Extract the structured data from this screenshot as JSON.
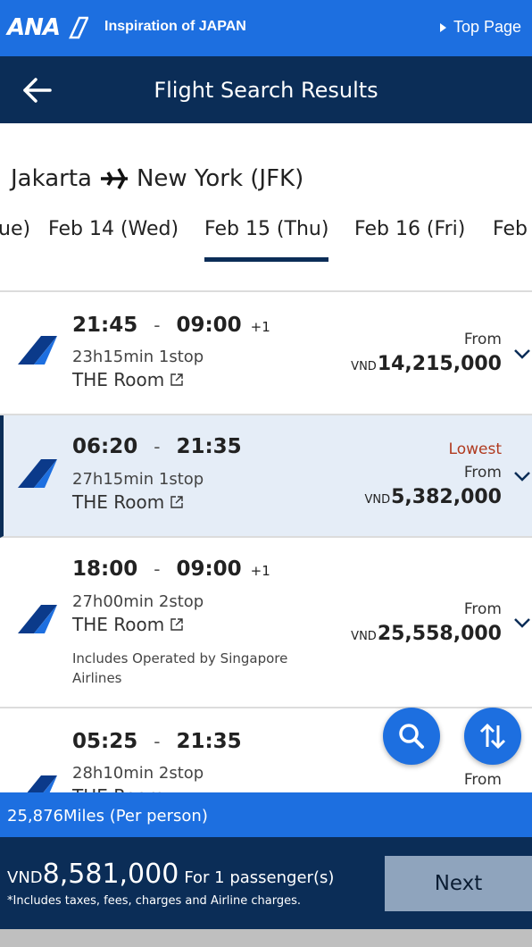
{
  "brand": {
    "logo_text": "ANA",
    "tagline": "Inspiration of JAPAN",
    "top_page": "Top Page"
  },
  "header": {
    "title": "Flight Search Results"
  },
  "route": {
    "origin": "Jakarta",
    "destination": "New York (JFK)"
  },
  "date_tabs": [
    {
      "label": "ue)",
      "active": false
    },
    {
      "label": "Feb 14 (Wed)",
      "active": false
    },
    {
      "label": "Feb 15 (Thu)",
      "active": true
    },
    {
      "label": "Feb 16 (Fri)",
      "active": false
    },
    {
      "label": "Feb",
      "active": false
    }
  ],
  "flights": [
    {
      "depart": "21:45",
      "arrive": "09:00",
      "day_offset": "+1",
      "duration": "23h15min 1stop",
      "lounge": "THE Room",
      "note": "",
      "badge": "",
      "from": "From",
      "currency": "VND",
      "price": "14,215,000",
      "selected": false
    },
    {
      "depart": "06:20",
      "arrive": "21:35",
      "day_offset": "",
      "duration": "27h15min 1stop",
      "lounge": "THE Room",
      "note": "",
      "badge": "Lowest",
      "from": "From",
      "currency": "VND",
      "price": "5,382,000",
      "selected": true
    },
    {
      "depart": "18:00",
      "arrive": "09:00",
      "day_offset": "+1",
      "duration": "27h00min 2stop",
      "lounge": "THE Room",
      "note": "Includes Operated by Singapore Airlines",
      "badge": "",
      "from": "From",
      "currency": "VND",
      "price": "25,558,000",
      "selected": false
    },
    {
      "depart": "05:25",
      "arrive": "21:35",
      "day_offset": "",
      "duration": "28h10min 2stop",
      "lounge": "THE Room",
      "note": "",
      "badge": "",
      "from": "From",
      "currency": "VND",
      "price": "",
      "selected": false
    }
  ],
  "miles": {
    "text": "25,876Miles (Per person)"
  },
  "total": {
    "currency": "VND",
    "amount": "8,581,000",
    "passengers": "For 1 passenger(s)",
    "note": "*Includes taxes, fees, charges and Airline charges.",
    "next_label": "Next"
  },
  "colors": {
    "brand_blue": "#1d6fe0",
    "navy": "#0b2d57",
    "selected_bg": "#e5edf7",
    "lowest_red": "#b03a1f"
  },
  "icons": {
    "back": "arrow-left-icon",
    "plane": "airplane-icon",
    "external": "external-link-icon",
    "chevron": "chevron-down-icon",
    "search": "search-icon",
    "sort": "sort-icon"
  }
}
